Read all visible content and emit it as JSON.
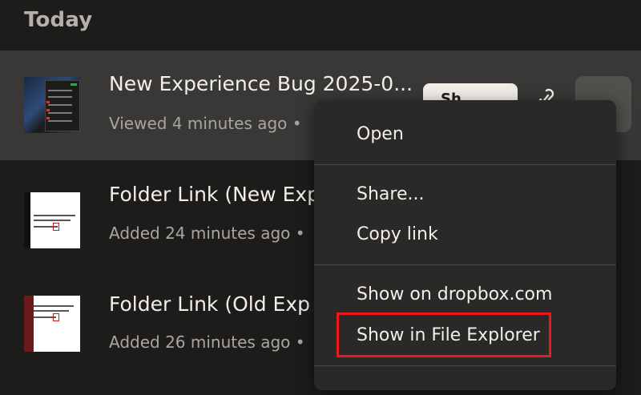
{
  "section": {
    "title": "Today"
  },
  "files": [
    {
      "name": "New Experience Bug 2025-0...",
      "meta": "Viewed 4 minutes ago •",
      "share_label": "Sh..."
    },
    {
      "name": "Folder Link (New Exp",
      "meta": "Added 24 minutes ago •"
    },
    {
      "name": "Folder Link (Old Exp",
      "meta": "Added 26 minutes ago •"
    }
  ],
  "context_menu": {
    "open": "Open",
    "share": "Share...",
    "copy_link": "Copy link",
    "show_on_web": "Show on dropbox.com",
    "show_in_explorer": "Show in File Explorer"
  },
  "icons": {
    "link": "link-icon",
    "more": "more-icon"
  },
  "colors": {
    "background": "#1e1c1b",
    "selected_row": "#3a3836",
    "menu_background": "#2b2928",
    "highlight": "#e8191f",
    "share_button": "#f1ede7"
  }
}
